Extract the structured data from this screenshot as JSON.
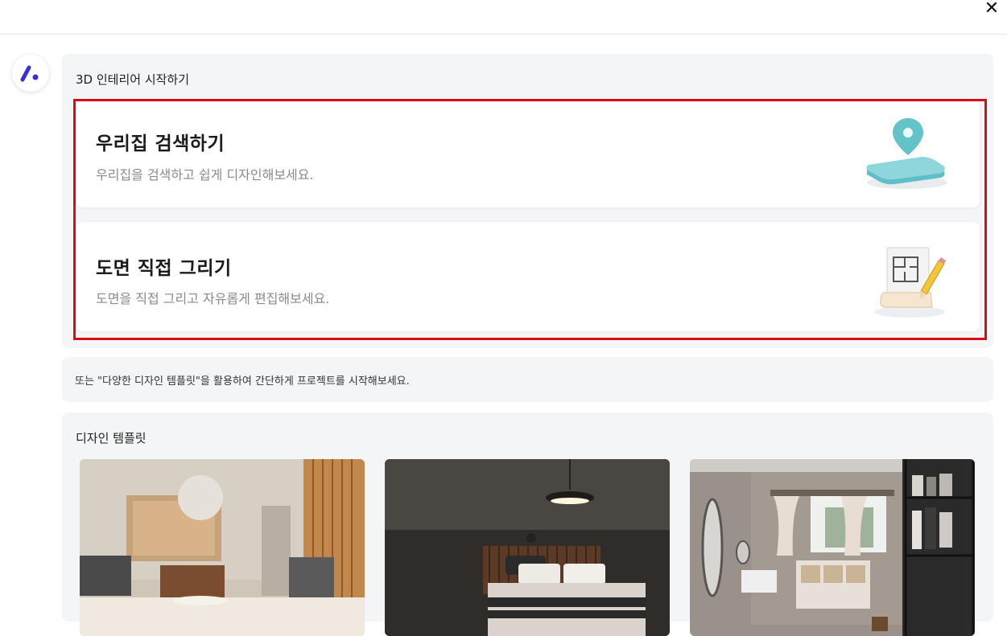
{
  "header": {
    "close_label": "✕"
  },
  "start_section": {
    "title": "3D 인테리어 시작하기",
    "cards": [
      {
        "title": "우리집 검색하기",
        "desc": "우리집을 검색하고 쉽게 디자인해보세요.",
        "icon": "map-pin-icon"
      },
      {
        "title": "도면 직접 그리기",
        "desc": "도면을 직접 그리고 자유롭게 편집해보세요.",
        "icon": "floorplan-pencil-icon"
      }
    ]
  },
  "hint": {
    "text": "또는 \"다양한 디자인 템플릿\"을 활용하여 간단하게 프로젝트를 시작해보세요."
  },
  "templates": {
    "title": "디자인 템플릿",
    "items": [
      {
        "icon": "living-room-photo"
      },
      {
        "icon": "bedroom-photo"
      },
      {
        "icon": "dressing-room-photo"
      }
    ]
  },
  "colors": {
    "accent": "#3a2fd6",
    "highlight": "#d60d14",
    "panel": "#f4f5f7"
  }
}
